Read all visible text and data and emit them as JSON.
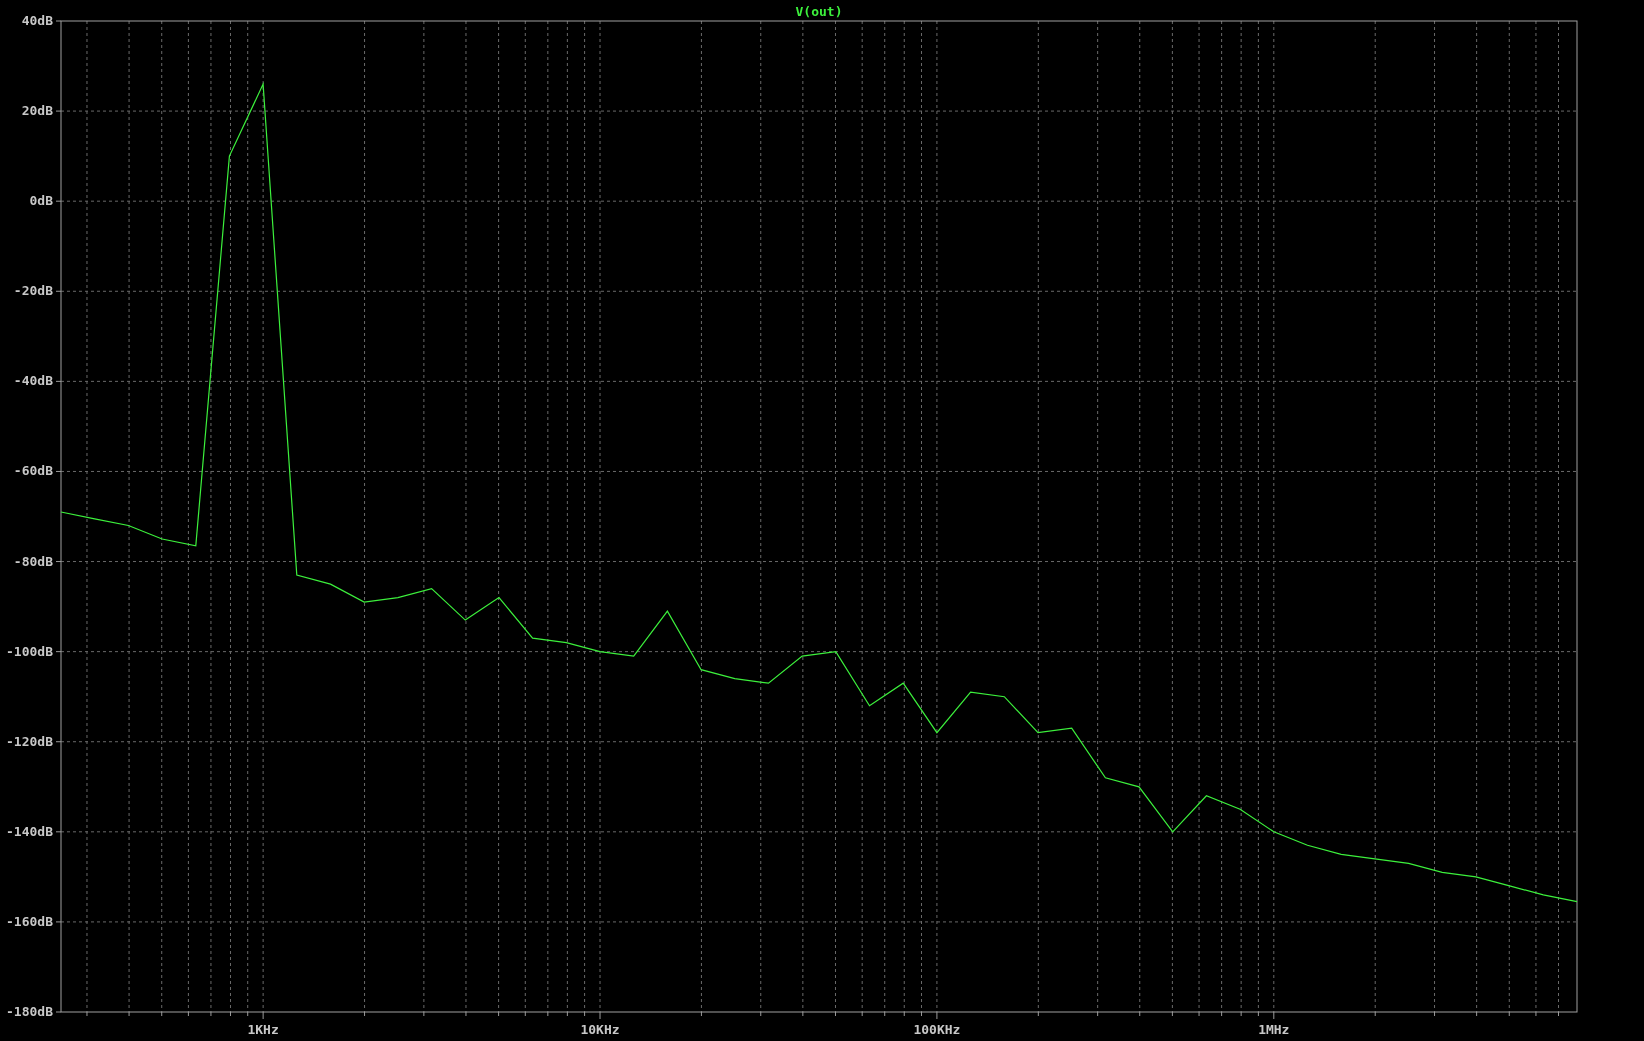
{
  "chart_data": {
    "type": "line",
    "categories": [
      null,
      null,
      null,
      null,
      null,
      null,
      "1KHz",
      null,
      null,
      null,
      null,
      null,
      null,
      null,
      null,
      null,
      "10KHz",
      null,
      null,
      null,
      null,
      null,
      null,
      null,
      null,
      null,
      "100KHz",
      null,
      null,
      null,
      null,
      null,
      null,
      null,
      null,
      null,
      "1MHz",
      null,
      null,
      null,
      null,
      null,
      null,
      null,
      null,
      null
    ],
    "series": [
      {
        "name": "V(out)",
        "color": "#3cf03c",
        "values": [
          -69,
          -70.5,
          -72,
          -75,
          -76.5,
          10,
          26,
          -83,
          -85,
          -89,
          -88,
          -86,
          -93,
          -88,
          -97,
          -98,
          -100,
          -101,
          -91,
          -104,
          -106,
          -107,
          -101,
          -100,
          -112,
          -107,
          -118,
          -109,
          -110,
          -118,
          -117,
          -128,
          -130,
          -140,
          -132,
          -135,
          -140,
          -143,
          -145,
          -146,
          -147,
          -149,
          -150,
          -152,
          -154,
          -155.5
        ]
      }
    ],
    "ylim": [
      -180,
      40
    ],
    "grid": true,
    "yticks": [
      {
        "value": 40,
        "label": "40dB"
      },
      {
        "value": 20,
        "label": "20dB"
      },
      {
        "value": 0,
        "label": "0dB"
      },
      {
        "value": -20,
        "label": "-20dB"
      },
      {
        "value": -40,
        "label": "-40dB"
      },
      {
        "value": -60,
        "label": "-60dB"
      },
      {
        "value": -80,
        "label": "-80dB"
      },
      {
        "value": -100,
        "label": "-100dB"
      },
      {
        "value": -120,
        "label": "-120dB"
      },
      {
        "value": -140,
        "label": "-140dB"
      },
      {
        "value": -160,
        "label": "-160dB"
      },
      {
        "value": -180,
        "label": "-180dB"
      }
    ]
  }
}
